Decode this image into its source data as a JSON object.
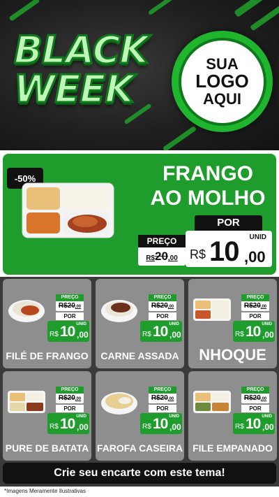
{
  "header": {
    "black": "BLACK",
    "week": "WEEK",
    "logo": {
      "line1": "SUA",
      "line2": "LOGO",
      "line3": "AQUI"
    }
  },
  "featured": {
    "discount": "-50%",
    "title_line1": "FRANGO",
    "title_line2": "AO MOLHO",
    "preco_label": "PREÇO",
    "old_currency": "R$",
    "old_price": "20",
    "old_cents": ",00",
    "por_label": "POR",
    "unid_label": "UNID",
    "new_currency": "R$",
    "new_price": "10",
    "new_cents": ",00"
  },
  "products": [
    {
      "name": "FILÉ DE FRANGO",
      "preco_label": "PREÇO",
      "old_price": "R$20",
      "old_cents": ",00",
      "por_label": "POR",
      "unid_label": "UNID",
      "currency": "R$",
      "price": "10",
      "cents": ",00"
    },
    {
      "name": "CARNE ASSADA",
      "preco_label": "PREÇO",
      "old_price": "R$20",
      "old_cents": ",00",
      "por_label": "POR",
      "unid_label": "UNID",
      "currency": "R$",
      "price": "10",
      "cents": ",00"
    },
    {
      "name": "NHOQUE",
      "preco_label": "PREÇO",
      "old_price": "R$20",
      "old_cents": ",00",
      "por_label": "POR",
      "unid_label": "UNID",
      "currency": "R$",
      "price": "10",
      "cents": ",00"
    },
    {
      "name": "PURE DE BATATA",
      "preco_label": "PREÇO",
      "old_price": "R$20",
      "old_cents": ",00",
      "por_label": "POR",
      "unid_label": "UNID",
      "currency": "R$",
      "price": "10",
      "cents": ",00"
    },
    {
      "name": "FAROFA CASEIRA",
      "preco_label": "PREÇO",
      "old_price": "R$20",
      "old_cents": ",00",
      "por_label": "POR",
      "unid_label": "UNID",
      "currency": "R$",
      "price": "10",
      "cents": ",00"
    },
    {
      "name": "FILE EMPANADO",
      "preco_label": "PREÇO",
      "old_price": "R$20",
      "old_cents": ",00",
      "por_label": "POR",
      "unid_label": "UNID",
      "currency": "R$",
      "price": "10",
      "cents": ",00"
    }
  ],
  "cta": "Crie seu encarte com este tema!",
  "footer_note": "*Imagens Meramente Ilustrativas",
  "colors": {
    "brand_green": "#1f9d2c",
    "dark": "#111111",
    "card_gray": "#8e8e8e"
  }
}
